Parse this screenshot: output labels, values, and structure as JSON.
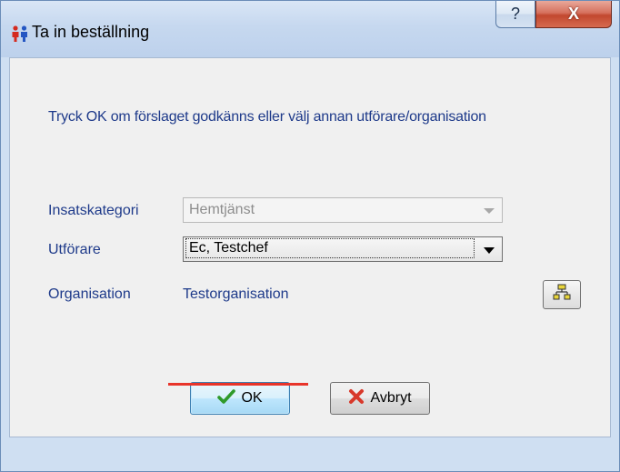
{
  "window": {
    "title": "Ta in beställning",
    "help_label": "?",
    "close_label": "X"
  },
  "form": {
    "instruction": "Tryck OK om förslaget godkänns eller välj annan utförare/organisation",
    "insatskategori_label": "Insatskategori",
    "insatskategori_value": "Hemtjänst",
    "utforare_label": "Utförare",
    "utforare_value": "Ec, Testchef",
    "organisation_label": "Organisation",
    "organisation_value": "Testorganisation"
  },
  "buttons": {
    "ok_label": "OK",
    "cancel_label": "Avbryt"
  },
  "icons": {
    "title": "people-icon",
    "org": "org-chart-icon",
    "ok": "checkmark-icon",
    "cancel": "x-cross-icon"
  },
  "colors": {
    "label_text": "#1e3a8a",
    "annotation_underline": "#e8342a"
  }
}
